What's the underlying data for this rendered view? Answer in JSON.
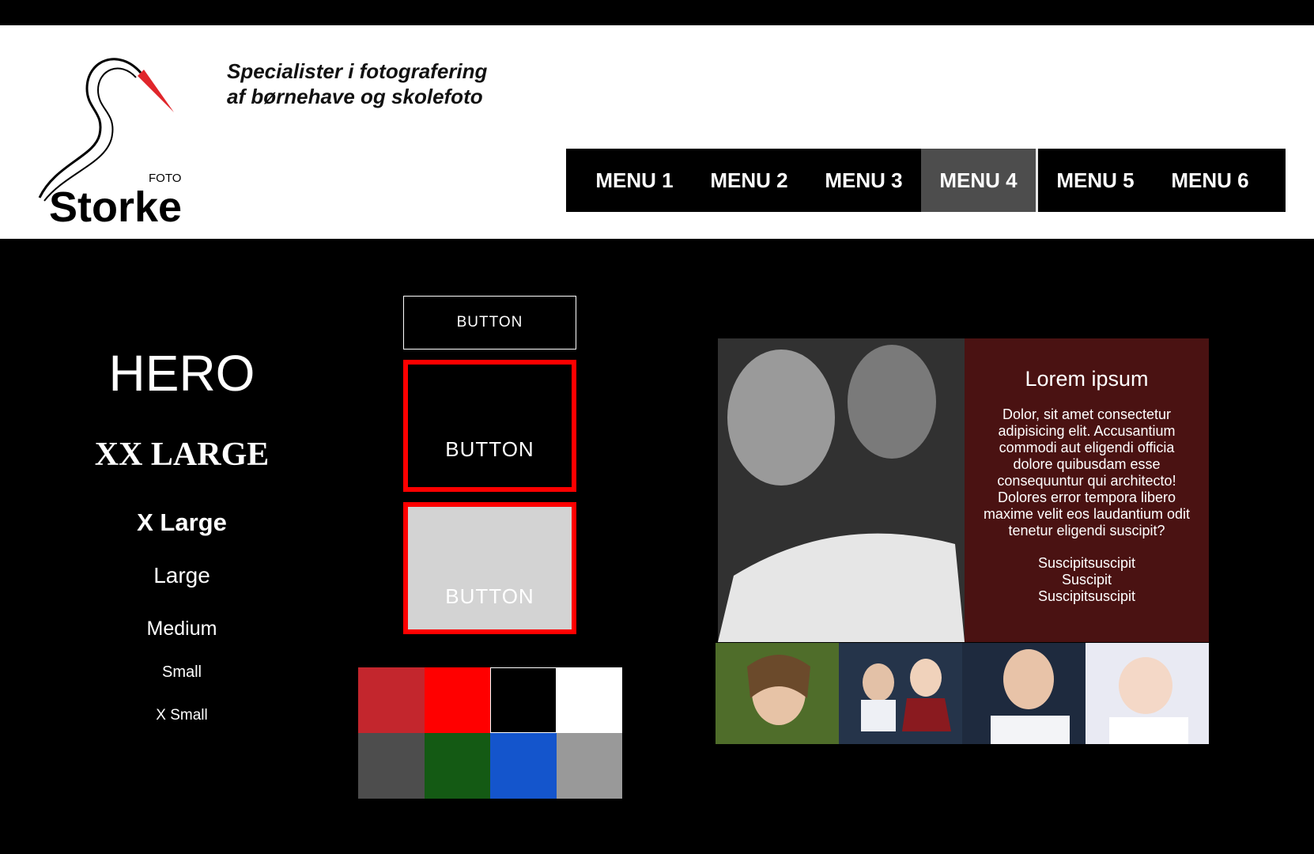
{
  "brand": {
    "wordmark": "Storke",
    "sup": "FOTO",
    "tagline_line1": "Specialister i fotografering",
    "tagline_line2": "af børnehave og skolefoto",
    "beak_color": "#e0262b"
  },
  "nav": {
    "active_index": 3,
    "items": [
      {
        "label": "MENU 1"
      },
      {
        "label": "MENU 2"
      },
      {
        "label": "MENU 3"
      },
      {
        "label": "MENU 4"
      },
      {
        "label": "MENU 5"
      },
      {
        "label": "MENU 6"
      }
    ]
  },
  "typography": {
    "hero": "HERO",
    "xx_large": "XX LARGE",
    "x_large": "X Large",
    "large": "Large",
    "medium": "Medium",
    "small": "Small",
    "x_small": "X Small"
  },
  "buttons": {
    "outline": "BUTTON",
    "red_border_dark": "BUTTON",
    "red_border_light": "BUTTON"
  },
  "palette": [
    {
      "color": "#c3262d"
    },
    {
      "color": "#ff0000"
    },
    {
      "color": "#000000"
    },
    {
      "color": "#ffffff"
    },
    {
      "color": "#4d4d4d"
    },
    {
      "color": "#145a14"
    },
    {
      "color": "#1455cc"
    },
    {
      "color": "#999999"
    }
  ],
  "feature": {
    "card_bg": "#4a1212",
    "title": "Lorem ipsum",
    "body": "Dolor, sit amet consectetur adipisicing elit. Accusantium commodi aut eligendi officia dolore quibusdam esse consequuntur qui architecto! Dolores error tempora libero maxime velit eos laudantium odit tenetur eligendi suscipit?",
    "extra": [
      "Suscipitsuscipit",
      "Suscipit",
      "Suscipitsuscipit"
    ]
  },
  "thumbnails": [
    {
      "icon": "girl-portrait-photo",
      "bg": "#4f6d2a"
    },
    {
      "icon": "siblings-photo",
      "bg": "#25344a"
    },
    {
      "icon": "laughing-boy-photo",
      "bg": "#1e2a3e"
    },
    {
      "icon": "baby-photo",
      "bg": "#e9eaf3"
    }
  ]
}
